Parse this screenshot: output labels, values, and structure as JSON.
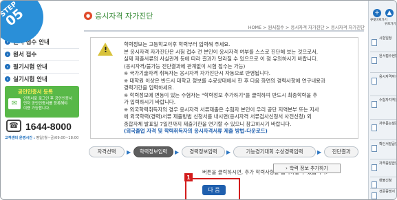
{
  "step": {
    "label": "STEP",
    "number": "05"
  },
  "left_nav": {
    "items": [
      {
        "label": "원서 접수 안내"
      },
      {
        "label": "원서 접수"
      },
      {
        "label": "필기시험 안내"
      },
      {
        "label": "실기시험 안내"
      }
    ],
    "cert_banner": {
      "title": "공인인증서 등록",
      "desc_lines": [
        "인증서로 로그인 후 공인인증서",
        "먼저 공인인증서를 등록해야",
        "이용 가능합니다."
      ]
    },
    "phone": "1644-8000",
    "hours_label": "고객센터 운영시간 :",
    "hours_value": "평일(월~금)09:00~18:00"
  },
  "main": {
    "title": "응시자격 자가진단",
    "breadcrumb": "HOME > 원서접수 > 응시자격 자가진단 > 응시자격 자가진단",
    "notice_lines": [
      "학력정보는 고등학교이후 학력부터 입력해 주세요.",
      "본 응시자격 자가진단은 시험 접수 전 본인이 응시자격 여부를 스스로 진단해 보는 것으로서,",
      "실제 제출서류의 사실관계 등에 따라 결과가 달라질 수 있으므로 이 점 유의하시기 바랍니다.",
      "(응시자격/불가능 진단결과에 관계없이 시험 접수는 가능)",
      "※ 국가기술자격 취득자는 응시자격 자가진단시 자동으로 반영됩니다.",
      "※ 대학원 이상은 반드시 대학교 정보를 수료상태에서 한 후 다음 화면의 경력사항에 연구내용과",
      "경력기간을 입력하세요.",
      "※ 학력정보에 변동이 있는 수험자는 \"학력정보 추가하기\"를 클릭하여 반드시 최종학력을 추",
      "가 입력하시기 바랍니다.",
      "※ 외국학력취득자의 경우 응시자격 서류제출은 수험자 본인이 우리 공단 지역본부 또는 지사",
      "에 외국학력(경력)서류 제출방법 신청서를 내시면(응시자격 서류검사신청서 사전신청) 외",
      "종합자체 발표일 7일전까지 제출기한을 연기할 수 있으니 참고하시기 바랍니다."
    ],
    "notice_link": "(외국졸업 자격 및 학력취득자의 응시자격서류 제출 방법-다운로드)",
    "tabs": [
      {
        "label": "자격선택",
        "active": false
      },
      {
        "label": "학력정보입력",
        "active": true
      },
      {
        "label": "경력정보입력",
        "active": false
      },
      {
        "label": "기능경기대회 수상경력입력",
        "active": false
      },
      {
        "label": "진단결과",
        "active": false
      }
    ],
    "instruction": "버튼을 클릭하시면, 추가 학력사항을 입력하실 수 있습니다.",
    "add_button": "학력 정보 추가하기",
    "next_button": "다 음",
    "marker": "1"
  },
  "right_nav": {
    "top": [
      {
        "label": "큐넷바로가기",
        "icon": "+"
      },
      {
        "label": "위로가기",
        "icon": "▲"
      }
    ],
    "items": [
      {
        "label": "시험일정"
      },
      {
        "label": "원서접수현황"
      },
      {
        "label": "응시자격자가진단"
      },
      {
        "label": "수험자지역검색"
      },
      {
        "label": "자주묻는질문"
      },
      {
        "label": "확인서발급안내"
      },
      {
        "label": "자격증발급안내"
      },
      {
        "label": "환불신청"
      },
      {
        "label": "전문증명서"
      }
    ]
  }
}
